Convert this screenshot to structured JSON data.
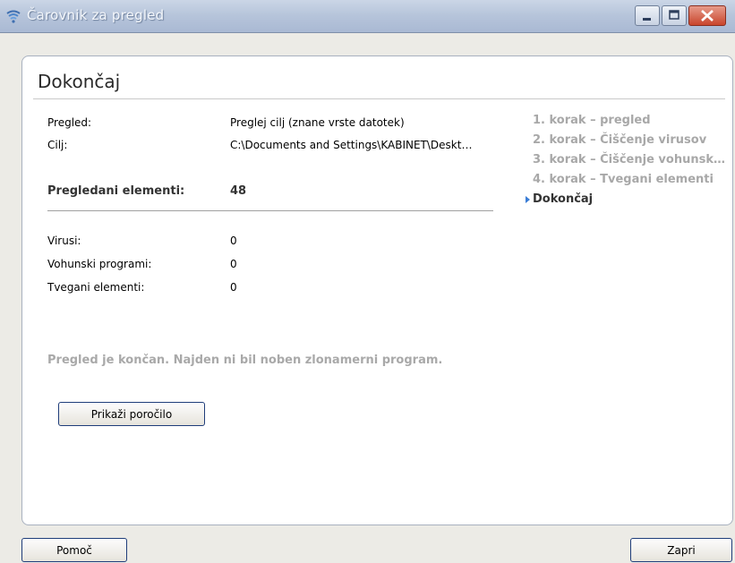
{
  "window": {
    "title": "Čarovnik za pregled",
    "icon": "scan-wizard-icon"
  },
  "page": {
    "title": "Dokončaj"
  },
  "scan": {
    "pregled_label": "Pregled:",
    "pregled_value": "Preglej cilj (znane vrste datotek)",
    "cilj_label": "Cilj:",
    "cilj_value": "C:\\Documents and Settings\\KABINET\\Deskt…",
    "elements_label": "Pregledani elementi:",
    "elements_value": "48",
    "virusi_label": "Virusi:",
    "virusi_value": "0",
    "spyware_label": "Vohunski programi:",
    "spyware_value": "0",
    "risky_label": "Tvegani elementi:",
    "risky_value": "0",
    "result_message": "Pregled je končan. Najden ni bil noben zlonamerni program."
  },
  "steps": [
    {
      "label": "1. korak – pregled"
    },
    {
      "label": "2. korak – Čiščenje virusov"
    },
    {
      "label": "3. korak – Čiščenje vohunsk…"
    },
    {
      "label": "4. korak – Tvegani elementi"
    },
    {
      "label": "Dokončaj",
      "active": true
    }
  ],
  "buttons": {
    "report": "Prikaži poročilo",
    "help": "Pomoč",
    "close": "Zapri"
  },
  "colors": {
    "accent": "#3a7dd6",
    "close_button": "#c9452c",
    "muted_text": "#a8a8a8"
  }
}
